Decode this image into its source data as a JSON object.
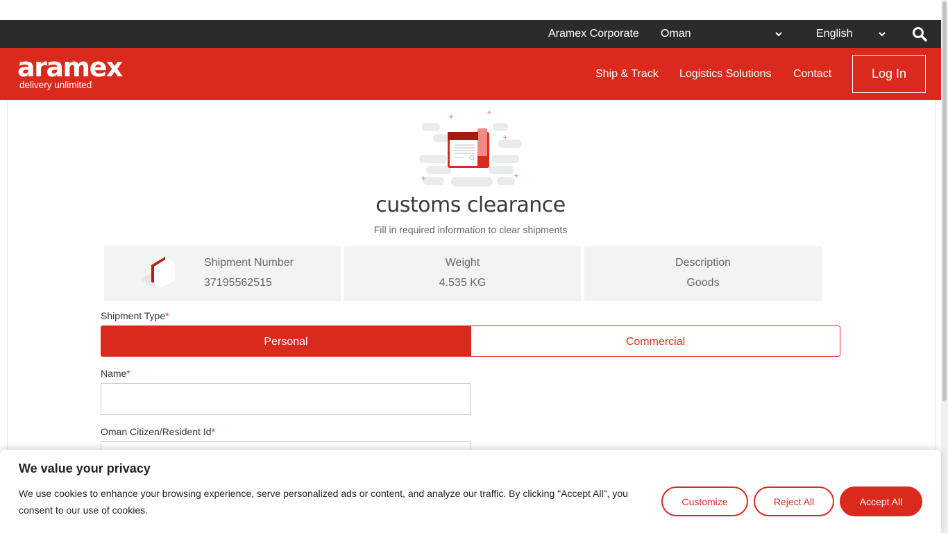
{
  "utility_bar": {
    "corporate_link": "Aramex Corporate",
    "country": "Oman",
    "language": "English",
    "icons": [
      "chevron-down-icon",
      "search-icon"
    ]
  },
  "header": {
    "logo_word": "aramex",
    "logo_tagline": "delivery unlimited",
    "nav": [
      "Ship & Track",
      "Logistics Solutions",
      "Contact"
    ],
    "login_label": "Log In"
  },
  "page": {
    "title": "customs clearance",
    "subtitle": "Fill in required information to clear shipments"
  },
  "shipment": {
    "number_label": "Shipment Number",
    "number_value": "37195562515",
    "weight_label": "Weight",
    "weight_value": "4.535 KG",
    "description_label": "Description",
    "description_value": "Goods"
  },
  "form": {
    "shipment_type_label": "Shipment Type",
    "required_mark": "*",
    "type_personal": "Personal",
    "type_commercial": "Commercial",
    "name_label": "Name",
    "name_value": "",
    "id_label": "Oman Citizen/Resident Id",
    "id_value": ""
  },
  "cookie_banner": {
    "title": "We value your privacy",
    "text": "We use cookies to enhance your browsing experience, serve personalized ads or content, and analyze our traffic. By clicking \"Accept All\", you consent to our use of cookies.",
    "customize": "Customize",
    "reject": "Reject All",
    "accept": "Accept All"
  },
  "colors": {
    "brand_red": "#dc291e",
    "utility_bar": "#2b2b2b",
    "card_bg": "#f1f3f4"
  }
}
